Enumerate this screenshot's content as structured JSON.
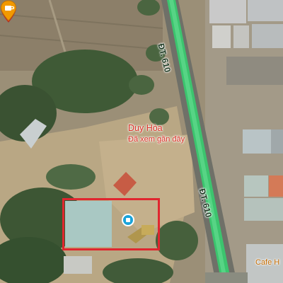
{
  "map": {
    "type": "satellite",
    "road": {
      "label_upper": "ĐT. 610",
      "label_lower": "ĐT. 610",
      "color": "#3cc46e"
    },
    "place": {
      "name": "Duy Hòa",
      "status": "Đã xem gần đây",
      "pin_color": "#ea4335",
      "pin_icon": "location-pin-icon"
    },
    "poi": {
      "icon": "shop-icon",
      "color": "#1aa3d9"
    },
    "cafe": {
      "label": "Cafe H",
      "icon": "coffee-cup-icon",
      "color": "#f29900"
    },
    "highlight": {
      "color": "#e0262f"
    }
  }
}
